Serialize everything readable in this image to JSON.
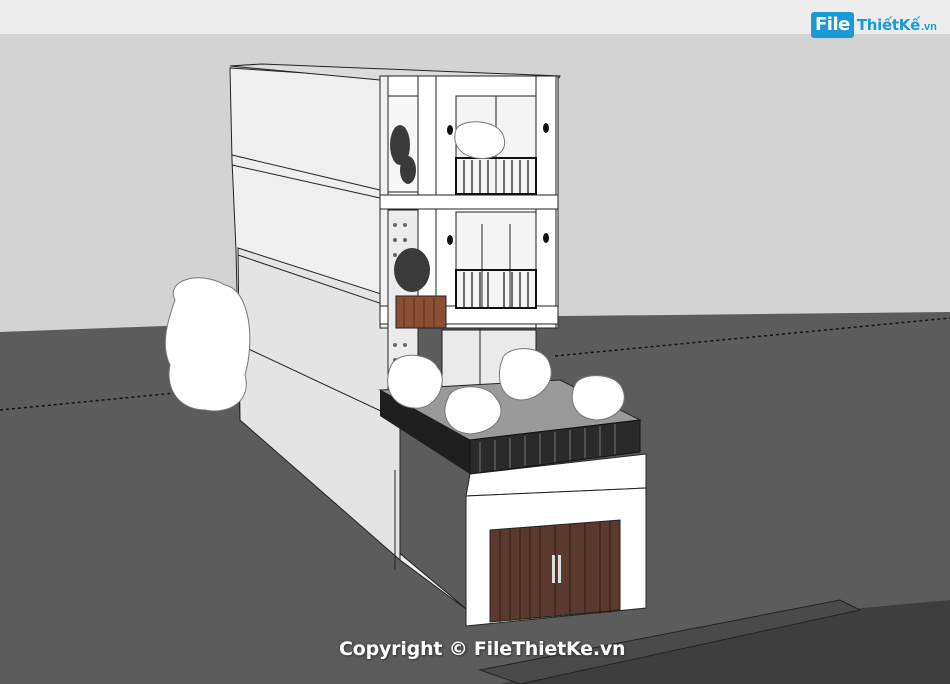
{
  "watermark": {
    "logo_file": "File",
    "logo_name": "ThiếtKế",
    "logo_domain": ".vn",
    "copyright": "Copyright © FileThietKe.vn"
  },
  "colors": {
    "sky": "#d4d4d4",
    "ground": "#5b5b5b",
    "wall": "#ffffff",
    "shade": "#e3e3e3",
    "railing": "#1e1e1e",
    "door_wood": "#5a3a2e",
    "planter_wood": "#8a4e33",
    "accent": "#1a9bd7"
  },
  "icons": {
    "tree": "tree-cloud-icon",
    "lamp": "wall-lamp-icon"
  }
}
